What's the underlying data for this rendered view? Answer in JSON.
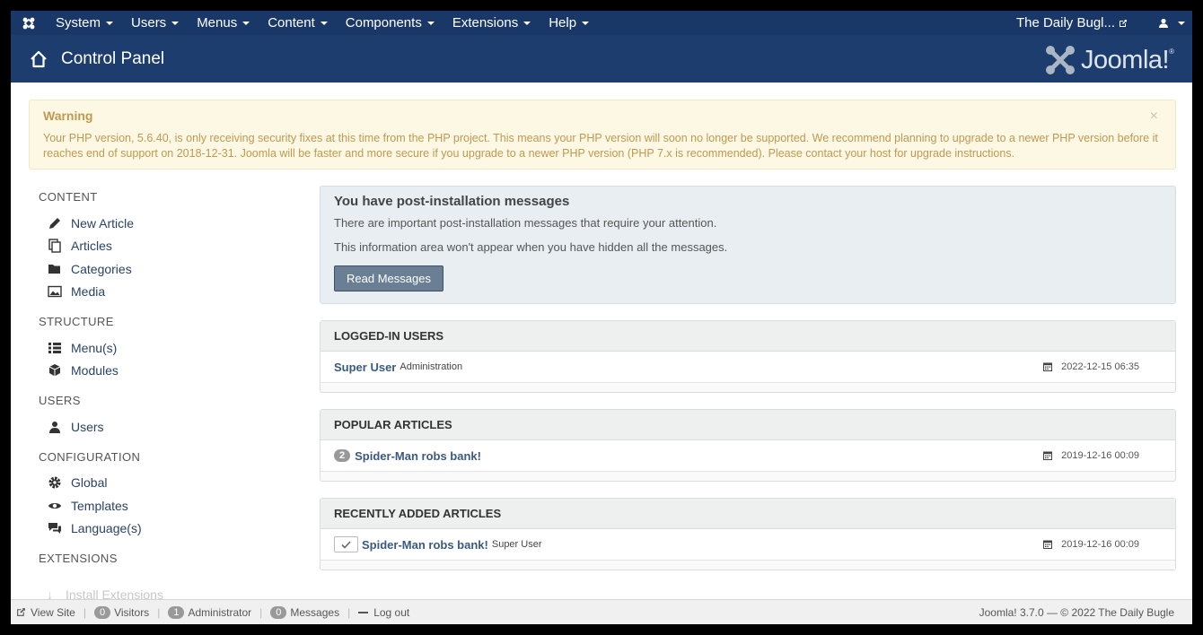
{
  "navbar": {
    "menus": [
      "System",
      "Users",
      "Menus",
      "Content",
      "Components",
      "Extensions",
      "Help"
    ],
    "site_name": "The Daily Bugl..."
  },
  "header": {
    "title": "Control Panel",
    "brand": "Joomla!",
    "brand_reg": "®"
  },
  "warning": {
    "title": "Warning",
    "text": "Your PHP version, 5.6.40, is only receiving security fixes at this time from the PHP project. This means your PHP version will soon no longer be supported. We recommend planning to upgrade to a newer PHP version before it reaches end of support on 2018-12-31. Joomla will be faster and more secure if you upgrade to a newer PHP version (PHP 7.x is recommended). Please contact your host for upgrade instructions.",
    "close": "×"
  },
  "sidebar": {
    "content_heading": "CONTENT",
    "content_items": [
      "New Article",
      "Articles",
      "Categories",
      "Media"
    ],
    "structure_heading": "STRUCTURE",
    "structure_items": [
      "Menu(s)",
      "Modules"
    ],
    "users_heading": "USERS",
    "users_items": [
      "Users"
    ],
    "config_heading": "CONFIGURATION",
    "config_items": [
      "Global",
      "Templates",
      "Language(s)"
    ],
    "extensions_heading": "EXTENSIONS",
    "extensions_items": [
      "Install Extensions"
    ]
  },
  "postinstall": {
    "title": "You have post-installation messages",
    "line1": "There are important post-installation messages that require your attention.",
    "line2": "This information area won't appear when you have hidden all the messages.",
    "button": "Read Messages"
  },
  "logged_in": {
    "heading": "LOGGED-IN USERS",
    "user": "Super User",
    "role": "Administration",
    "date": "2022-12-15 06:35"
  },
  "popular": {
    "heading": "POPULAR ARTICLES",
    "hits": "2",
    "title": "Spider-Man robs bank!",
    "date": "2019-12-16 00:09"
  },
  "recent": {
    "heading": "RECENTLY ADDED ARTICLES",
    "title": "Spider-Man robs bank!",
    "author": "Super User",
    "date": "2019-12-16 00:09"
  },
  "statusbar": {
    "view_site": "View Site",
    "visitors_count": "0",
    "visitors": "Visitors",
    "admin_count": "1",
    "admin": "Administrator",
    "messages_count": "0",
    "messages": "Messages",
    "logout": "Log out",
    "version": "Joomla! 3.7.0  —  © 2022 The Daily Bugle"
  },
  "colors": {
    "navbar": "#1a3867",
    "header": "#1c3d6e",
    "warning_bg": "#fcf8e3",
    "warning_text": "#c09853",
    "button": "#6a7f93"
  }
}
